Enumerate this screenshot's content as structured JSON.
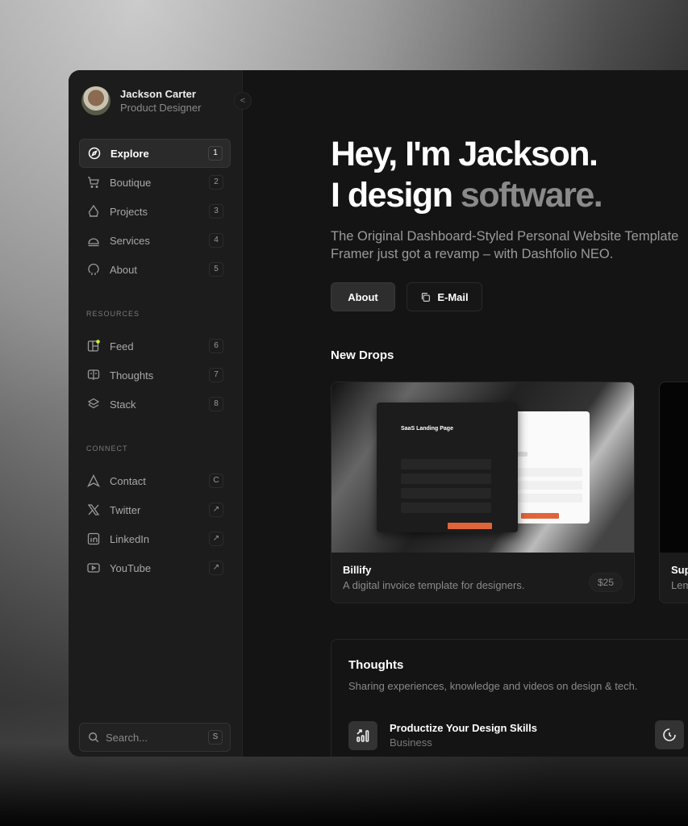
{
  "profile": {
    "name": "Jackson Carter",
    "role": "Product Designer"
  },
  "nav": [
    {
      "label": "Explore",
      "key": "1",
      "icon": "compass-icon",
      "active": true
    },
    {
      "label": "Boutique",
      "key": "2",
      "icon": "cart-icon"
    },
    {
      "label": "Projects",
      "key": "3",
      "icon": "pen-tool-icon"
    },
    {
      "label": "Services",
      "key": "4",
      "icon": "bell-service-icon"
    },
    {
      "label": "About",
      "key": "5",
      "icon": "about-icon"
    }
  ],
  "resources": {
    "label": "RESOURCES",
    "items": [
      {
        "label": "Feed",
        "key": "6",
        "icon": "feed-icon"
      },
      {
        "label": "Thoughts",
        "key": "7",
        "icon": "book-icon"
      },
      {
        "label": "Stack",
        "key": "8",
        "icon": "layers-icon"
      }
    ]
  },
  "connect": {
    "label": "CONNECT",
    "items": [
      {
        "label": "Contact",
        "key": "C",
        "icon": "send-icon"
      },
      {
        "label": "Twitter",
        "key": "↗",
        "icon": "x-icon"
      },
      {
        "label": "LinkedIn",
        "key": "↗",
        "icon": "linkedin-icon"
      },
      {
        "label": "YouTube",
        "key": "↗",
        "icon": "youtube-icon"
      }
    ]
  },
  "search": {
    "placeholder": "Search...",
    "key": "S"
  },
  "hero": {
    "line1": "Hey, I'm Jackson.",
    "line2a": "I design ",
    "line2b": "software.",
    "subtitle1": "The Original Dashboard-Styled Personal Website Template",
    "subtitle2": "Framer just got a revamp – with Dashfolio NEO."
  },
  "buttons": {
    "about": "About",
    "email": "E-Mail"
  },
  "drops": {
    "title": "New Drops",
    "cards": [
      {
        "title": "Billify",
        "desc": "A digital invoice template for designers.",
        "price": "$25",
        "preview_title": "SaaS Landing Page"
      },
      {
        "title": "Sup",
        "desc": "Lem"
      }
    ]
  },
  "thoughts": {
    "title": "Thoughts",
    "subtitle": "Sharing experiences, knowledge and videos on design & tech.",
    "items": [
      {
        "title": "Productize Your Design Skills",
        "category": "Business"
      }
    ]
  },
  "colors": {
    "accent": "#e0643a",
    "feed_dot": "#c6f432"
  }
}
